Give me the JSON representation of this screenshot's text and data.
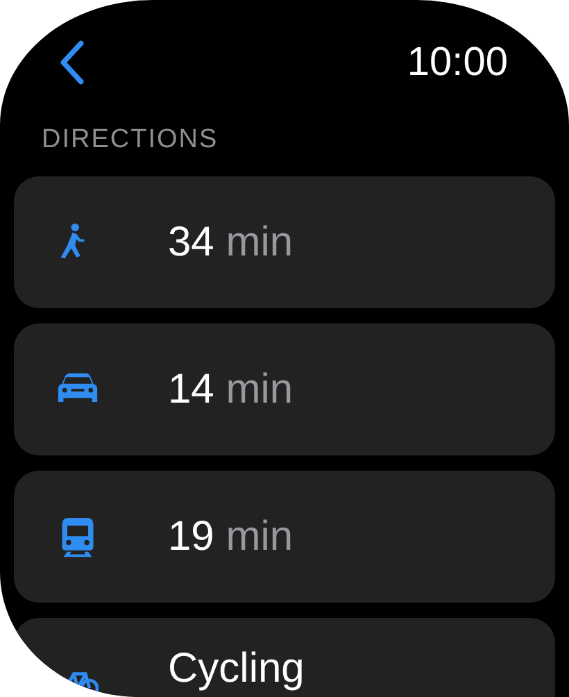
{
  "header": {
    "time": "10:00"
  },
  "section_title": "DIRECTIONS",
  "options": [
    {
      "kind": "walk",
      "value": "34",
      "unit": "min"
    },
    {
      "kind": "car",
      "value": "14",
      "unit": "min"
    },
    {
      "kind": "train",
      "value": "19",
      "unit": "min"
    },
    {
      "kind": "bike",
      "label": "Cycling"
    }
  ]
}
